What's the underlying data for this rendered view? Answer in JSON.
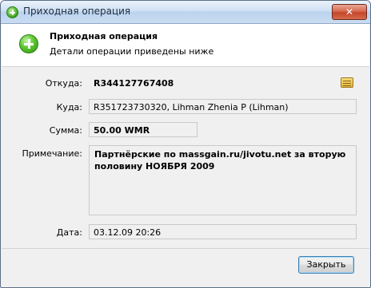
{
  "window": {
    "title": "Приходная операция",
    "close_label": "✕"
  },
  "header": {
    "title": "Приходная операция",
    "subtitle": "Детали операции приведены ниже"
  },
  "fields": {
    "from": {
      "label": "Откуда:",
      "value": "R344127767408"
    },
    "to": {
      "label": "Куда:",
      "value": "R351723730320, Lihman Zhenia P (Lihman)"
    },
    "amount": {
      "label": "Сумма:",
      "value": "50.00 WMR"
    },
    "note": {
      "label": "Примечание:",
      "value": "Партнёрские по massgain.ru/jivotu.net за вторую половину НОЯБРЯ 2009"
    },
    "date": {
      "label": "Дата:",
      "value": "03.12.09 20:26"
    }
  },
  "buttons": {
    "close_label": "Закрыть"
  },
  "icons": {
    "window": "add-icon",
    "header": "add-icon",
    "address_book": "address-book-icon"
  }
}
